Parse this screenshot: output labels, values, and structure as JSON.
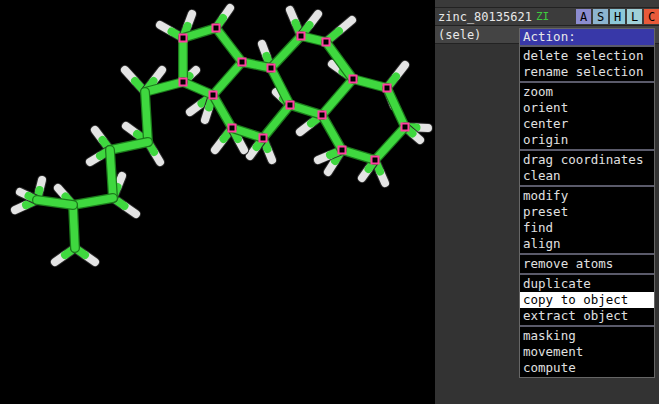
{
  "object_panel": {
    "rows": [
      {
        "name": "zinc_80135621",
        "state": "ZI",
        "buttons": [
          {
            "label": "A",
            "color": "#8c8cd0"
          },
          {
            "label": "S",
            "color": "#8cb4d0"
          },
          {
            "label": "H",
            "color": "#8cc8d8"
          },
          {
            "label": "L",
            "color": "#a0d0d8"
          },
          {
            "label": "C",
            "color": "#e85a3a"
          }
        ]
      },
      {
        "name": "(sele)",
        "state": "",
        "buttons": []
      }
    ]
  },
  "menu": {
    "title": "Action:",
    "groups": [
      [
        {
          "label": "delete selection",
          "selected": false
        },
        {
          "label": "rename selection",
          "selected": false
        }
      ],
      [
        {
          "label": "zoom",
          "selected": false
        },
        {
          "label": "orient",
          "selected": false
        },
        {
          "label": "center",
          "selected": false
        },
        {
          "label": "origin",
          "selected": false
        }
      ],
      [
        {
          "label": "drag coordinates",
          "selected": false
        },
        {
          "label": "clean",
          "selected": false
        }
      ],
      [
        {
          "label": "modify",
          "selected": false
        },
        {
          "label": "preset",
          "selected": false
        },
        {
          "label": "find",
          "selected": false
        },
        {
          "label": "align",
          "selected": false
        }
      ],
      [
        {
          "label": "remove atoms",
          "selected": false
        }
      ],
      [
        {
          "label": "duplicate",
          "selected": false
        },
        {
          "label": "copy to object",
          "selected": true
        },
        {
          "label": "extract object",
          "selected": false
        }
      ],
      [
        {
          "label": "masking",
          "selected": false
        },
        {
          "label": "movement",
          "selected": false
        },
        {
          "label": "compute",
          "selected": false
        }
      ]
    ]
  }
}
